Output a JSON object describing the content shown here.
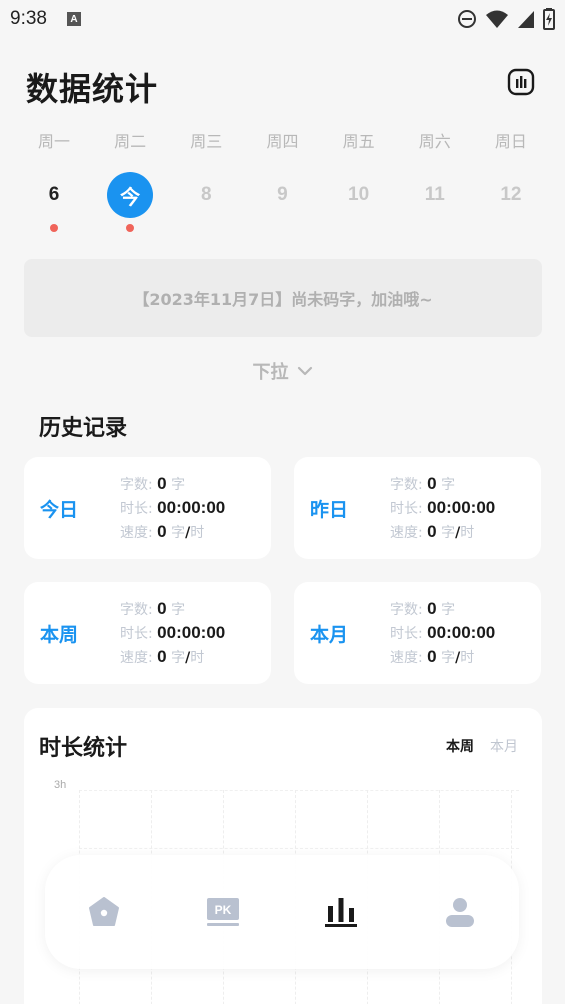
{
  "status_bar": {
    "time": "9:38",
    "notif_letter": "A"
  },
  "header": {
    "title": "数据统计"
  },
  "week": {
    "days": [
      {
        "label": "周一",
        "date": "6",
        "state": "past",
        "dot": true
      },
      {
        "label": "周二",
        "date": "今",
        "state": "today",
        "dot": true
      },
      {
        "label": "周三",
        "date": "8",
        "state": "future",
        "dot": false
      },
      {
        "label": "周四",
        "date": "9",
        "state": "future",
        "dot": false
      },
      {
        "label": "周五",
        "date": "10",
        "state": "future",
        "dot": false
      },
      {
        "label": "周六",
        "date": "11",
        "state": "future",
        "dot": false
      },
      {
        "label": "周日",
        "date": "12",
        "state": "future",
        "dot": false
      }
    ]
  },
  "notice": {
    "text": "【2023年11月7日】尚未码字，加油哦~"
  },
  "pull": {
    "label": "下拉"
  },
  "history": {
    "title": "历史记录",
    "field_labels": {
      "count": "字数:",
      "duration": "时长:",
      "speed": "速度:"
    },
    "units": {
      "char": "字",
      "slash": "/",
      "hour": "时"
    },
    "cards": [
      {
        "label": "今日",
        "count": "0",
        "duration": "00:00:00",
        "speed": "0"
      },
      {
        "label": "昨日",
        "count": "0",
        "duration": "00:00:00",
        "speed": "0"
      },
      {
        "label": "本周",
        "count": "0",
        "duration": "00:00:00",
        "speed": "0"
      },
      {
        "label": "本月",
        "count": "0",
        "duration": "00:00:00",
        "speed": "0"
      }
    ]
  },
  "duration_stats": {
    "title": "时长统计",
    "tabs": [
      {
        "label": "本周",
        "active": true
      },
      {
        "label": "本月",
        "active": false
      }
    ],
    "y_top_tick": "3h"
  },
  "nav": {
    "items": [
      "home-icon",
      "pk-icon",
      "stats-icon",
      "profile-icon"
    ],
    "active": "stats-icon"
  },
  "colors": {
    "accent": "#1a93f0",
    "dot": "#f0645a",
    "nav_inactive": "#b9c1d0",
    "nav_active": "#1a1a1a"
  }
}
